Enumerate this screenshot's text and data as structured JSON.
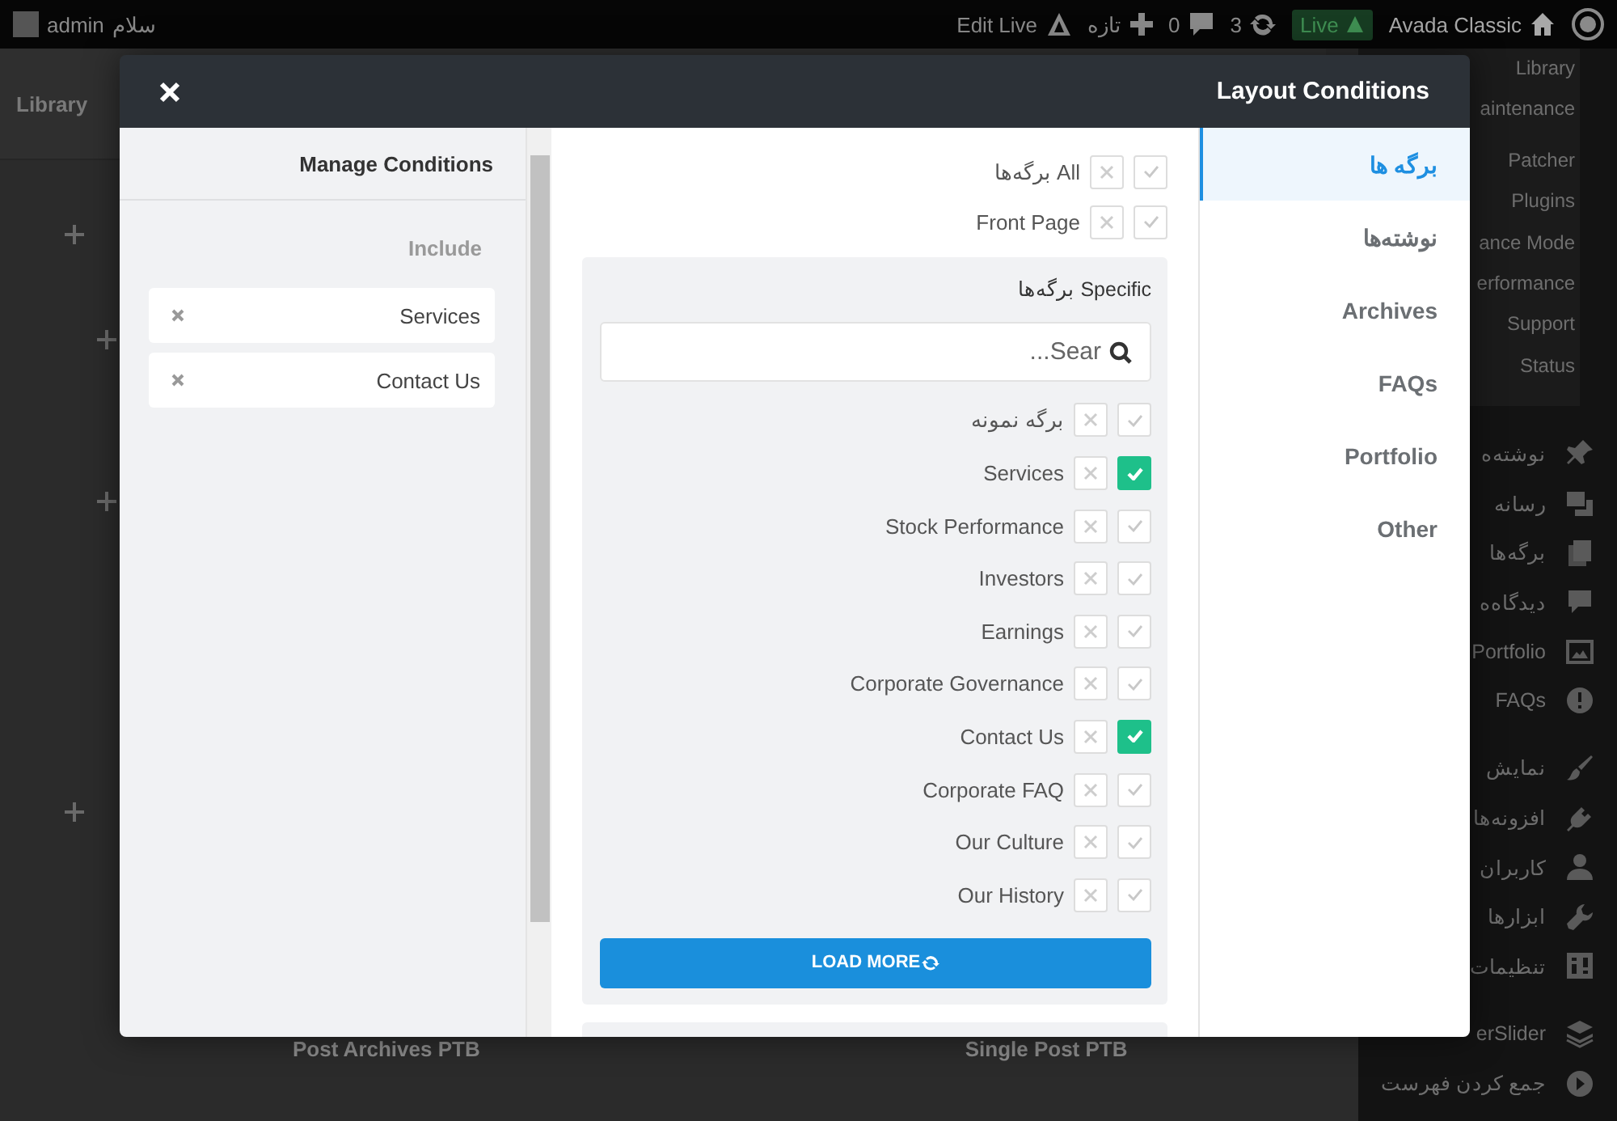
{
  "admin_bar": {
    "greeting": "سلام",
    "user": "admin",
    "edit_live": "Edit Live",
    "new": "تازه",
    "comments": "0",
    "updates": "3",
    "live": "Live",
    "site": "Avada Classic"
  },
  "sidebar": {
    "submenu": [
      "Library",
      "aintenance",
      "Patcher",
      "Plugins",
      "ance Mode",
      "erformance",
      "Support",
      "Status"
    ],
    "menu": [
      {
        "label": "نوشته‌ه",
        "kind": "pin"
      },
      {
        "label": "رسانه",
        "kind": "media"
      },
      {
        "label": "برگه‌ها",
        "kind": "pages"
      },
      {
        "label": "دیدگاه‌ه",
        "kind": "comment"
      },
      {
        "label": "Portfolio",
        "kind": "portfolio"
      },
      {
        "label": "FAQs",
        "kind": "info"
      },
      {
        "label": "نمایش",
        "kind": "brush"
      },
      {
        "label": "افزونه‌ها",
        "kind": "plugin"
      },
      {
        "label": "کاربران",
        "kind": "user"
      },
      {
        "label": "ابزارها",
        "kind": "wrench"
      },
      {
        "label": "تنظیمات",
        "kind": "settings"
      },
      {
        "label": "erSlider",
        "kind": "layers"
      },
      {
        "label": "جمع کردن فهرست",
        "kind": "collapse"
      }
    ]
  },
  "content": {
    "title": "Library",
    "footer_items": [
      "Single Post PTB",
      "Post Archives PTB"
    ]
  },
  "modal": {
    "title": "Layout Conditions",
    "manage": {
      "title": "Manage Conditions",
      "group": "Include",
      "items": [
        "Services",
        "Contact Us"
      ]
    },
    "options": [
      {
        "label": "All برگه‌ها",
        "excluded": false,
        "checked": false
      },
      {
        "label": "Front Page",
        "excluded": false,
        "checked": false
      }
    ],
    "specific": {
      "title": "Specific برگه‌ها",
      "placeholder": "Sear...",
      "items": [
        {
          "label": "برگه نمونه",
          "excluded": false,
          "checked": false
        },
        {
          "label": "Services",
          "excluded": false,
          "checked": true
        },
        {
          "label": "Stock Performance",
          "excluded": false,
          "checked": false
        },
        {
          "label": "Investors",
          "excluded": false,
          "checked": false
        },
        {
          "label": "Earnings",
          "excluded": false,
          "checked": false
        },
        {
          "label": "Corporate Governance",
          "excluded": false,
          "checked": false
        },
        {
          "label": "Contact Us",
          "excluded": false,
          "checked": true
        },
        {
          "label": "Corporate FAQ",
          "excluded": false,
          "checked": false
        },
        {
          "label": "Our Culture",
          "excluded": false,
          "checked": false
        },
        {
          "label": "Our History",
          "excluded": false,
          "checked": false
        }
      ],
      "load_more": "LOAD MORE"
    },
    "tabs": [
      {
        "label": "برگه ها",
        "selected": true
      },
      {
        "label": "نوشته‌ها",
        "selected": false
      },
      {
        "label": "Archives",
        "selected": false
      },
      {
        "label": "FAQs",
        "selected": false
      },
      {
        "label": "Portfolio",
        "selected": false
      },
      {
        "label": "Other",
        "selected": false
      }
    ]
  }
}
